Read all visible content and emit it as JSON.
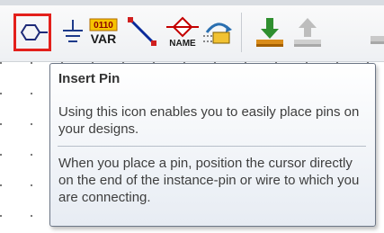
{
  "toolbar": {
    "buttons": [
      {
        "icon": "insert-pin-icon",
        "selected": true,
        "accent": "#e3201b"
      },
      {
        "icon": "ground-icon"
      },
      {
        "icon": "var-icon",
        "top_text": "0110",
        "bottom_text": "VAR"
      },
      {
        "icon": "wire-icon",
        "color": "#0a2a9a"
      },
      {
        "icon": "name-icon",
        "text": "NAME",
        "color": "#c40000"
      },
      {
        "icon": "bus-ripper-icon"
      },
      {
        "icon": "download-icon",
        "color": "#2f8f2f"
      },
      {
        "icon": "upload-icon"
      }
    ]
  },
  "tooltip": {
    "title": "Insert Pin",
    "paragraph_1": "Using this icon enables you to easily place pins on your designs.",
    "paragraph_2": "When you place a pin, position the cursor directly on the end of the instance-pin or wire to which you are connecting."
  }
}
